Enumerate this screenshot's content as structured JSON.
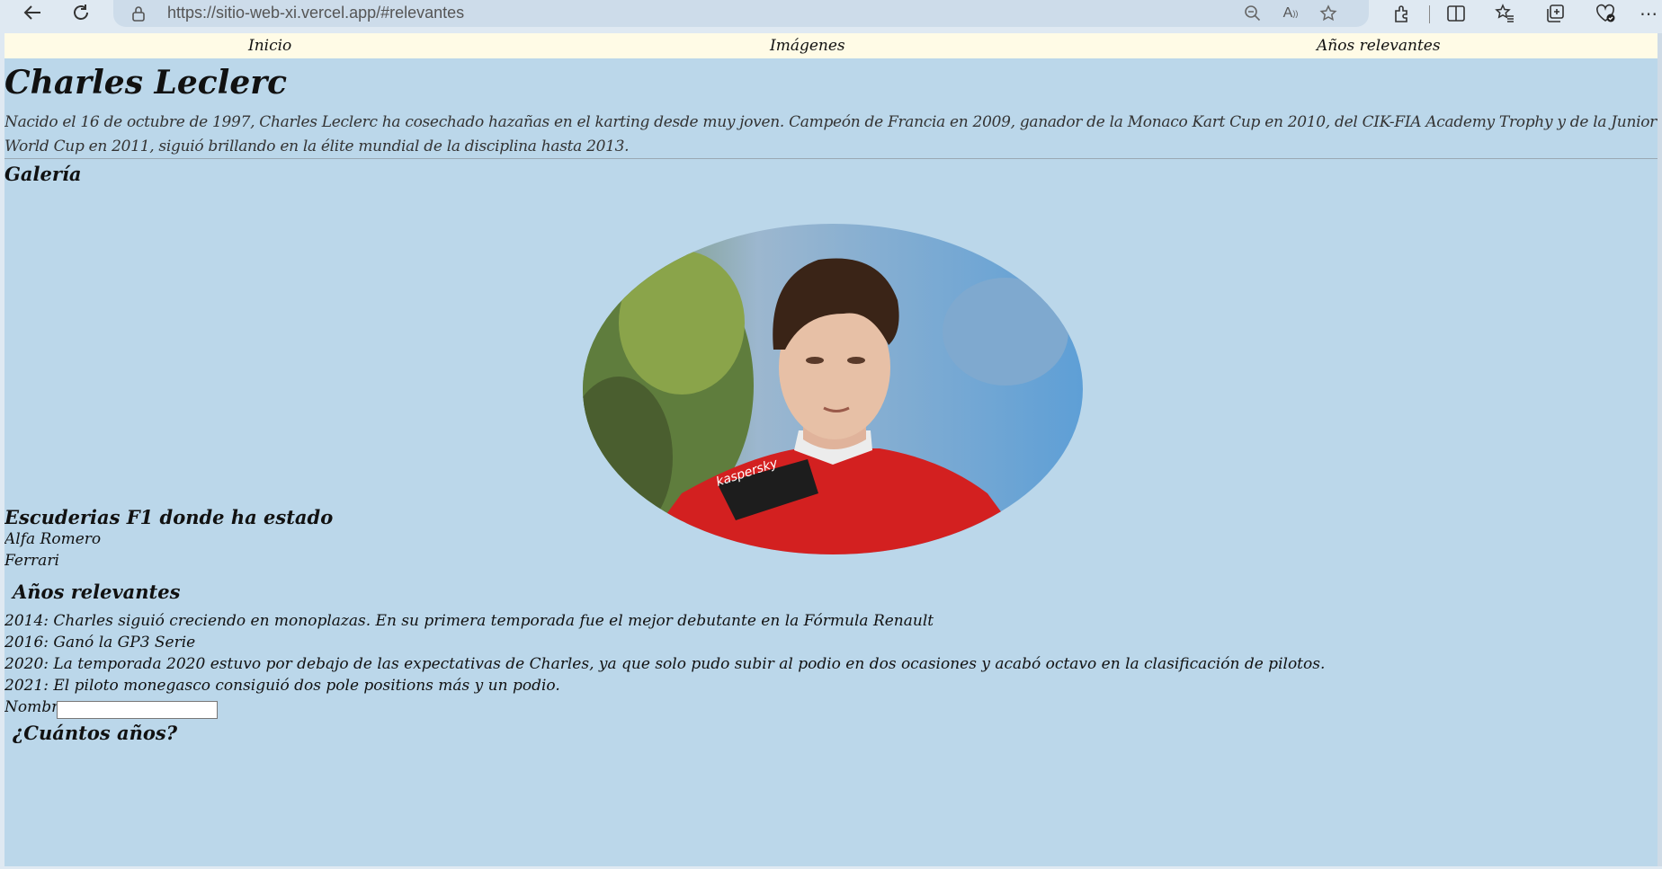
{
  "browser": {
    "url_prefix": "https://",
    "url_host": "sitio-web-xi.vercel.app",
    "url_path": "/#relevantes",
    "icons": [
      "back-icon",
      "refresh-icon",
      "lock-icon",
      "zoom-out-icon",
      "read-aloud-icon",
      "favorite-star-icon",
      "extensions-icon",
      "split-screen-icon",
      "favorites-icon",
      "collections-icon",
      "browser-essentials-icon",
      "more-icon"
    ]
  },
  "nav": {
    "items": [
      "Inicio",
      "Imágenes",
      "Años relevantes"
    ]
  },
  "header": {
    "title": "Charles Leclerc",
    "intro": "Nacido el 16 de octubre de 1997, Charles Leclerc ha cosechado hazañas en el karting desde muy joven. Campeón de Francia en 2009, ganador de la Monaco Kart Cup en 2010, del CIK-FIA Academy Trophy y de la Junior World Cup en 2011, siguió brillando en la élite mundial de la disciplina hasta 2013."
  },
  "gallery": {
    "heading": "Galería"
  },
  "teams": {
    "heading": "Escuderias F1 donde ha estado",
    "items": [
      "Alfa Romero",
      "Ferrari"
    ]
  },
  "years": {
    "heading": "Años relevantes",
    "items": [
      "2014: Charles siguió creciendo en monoplazas. En su primera temporada fue el mejor debutante en la Fórmula Renault",
      "2016: Ganó la GP3 Serie",
      "2020: La temporada 2020 estuvo por debajo de las expectativas de Charles, ya que solo pudo subir al podio en dos ocasiones y acabó octavo en la clasificación de pilotos.",
      "2021: El piloto monegasco consiguió dos pole positions más y un podio."
    ]
  },
  "form": {
    "name_label": "Nombre",
    "name_value": "",
    "next_heading": "¿Cuántos años?"
  },
  "colors": {
    "page_bg": "#bbd7ea",
    "nav_bg": "#fffbe6",
    "chrome_bg": "#dfe9f2",
    "address_bg": "#cddcea"
  }
}
